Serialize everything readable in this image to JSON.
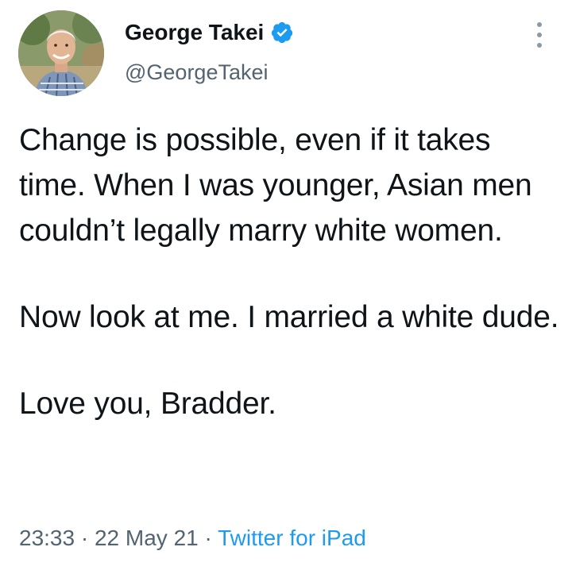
{
  "author": {
    "name": "George Takei",
    "handle": "@GeorgeTakei",
    "verified": true,
    "avatar_icon": "profile-photo"
  },
  "tweet": {
    "paragraphs": [
      "Change is possible, even if it takes time. When I was younger, Asian men couldn’t legally marry white women.",
      "Now look at me. I married a white dude.",
      "Love you, Bradder."
    ]
  },
  "meta": {
    "time": "23:33",
    "separator": "·",
    "date": "22 May 21",
    "source": "Twitter for iPad"
  },
  "icons": {
    "verified": "verified-badge-icon",
    "more": "more-vertical-icon"
  },
  "colors": {
    "text": "#0f1419",
    "secondary": "#536471",
    "link": "#1d9bf0",
    "verified": "#1d9bf0"
  }
}
